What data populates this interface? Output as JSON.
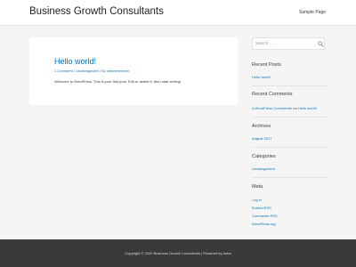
{
  "header": {
    "site_title": "Business Growth Consultants",
    "nav": [
      "Sample Page"
    ]
  },
  "post": {
    "title": "Hello world!",
    "meta": {
      "comments": "1 Comment",
      "category": "Uncategorized",
      "by": "By",
      "author": "wirkmmermon"
    },
    "excerpt": "Welcome to WordPress. This is your first post. Edit or delete it, then start writing!"
  },
  "sidebar": {
    "search": {
      "placeholder": "Search ..."
    },
    "recent_posts": {
      "title": "Recent Posts",
      "items": [
        "Hello world!"
      ]
    },
    "recent_comments": {
      "title": "Recent Comments",
      "author": "A WordPress Commenter",
      "on": "on",
      "post": "Hello world!"
    },
    "archives": {
      "title": "Archives",
      "items": [
        "August 2017"
      ]
    },
    "categories": {
      "title": "Categories",
      "items": [
        "Uncategorized"
      ]
    },
    "meta": {
      "title": "Meta",
      "items": [
        "Log in",
        "Entries RSS",
        "Comments RSS",
        "WordPress.org"
      ]
    }
  },
  "footer": {
    "text": "Copyright © 2020 Business Growth Consultants | Powered by Astra"
  },
  "colors": {
    "accent": "#0274be",
    "background": "#f5f5f5",
    "footer": "#3a3a3a"
  }
}
